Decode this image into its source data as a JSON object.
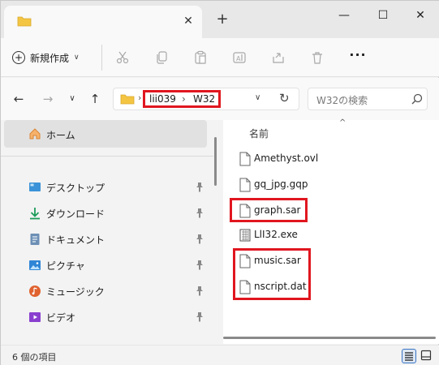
{
  "window": {
    "tab_title": "",
    "controls": {
      "minimize": "—",
      "maximize": "☐",
      "close": "✕"
    }
  },
  "tabbar": {
    "close_glyph": "✕",
    "add_glyph": "+"
  },
  "toolbar": {
    "new_label": "新規作成",
    "new_chevron": "∨",
    "more_glyph": "···",
    "icons": [
      "cut-icon",
      "copy-icon",
      "paste-icon",
      "rename-icon",
      "share-icon",
      "delete-icon"
    ]
  },
  "address": {
    "path": [
      "lii039",
      "W32"
    ],
    "separator": "›",
    "dropdown_glyph": "∨",
    "refresh_glyph": "↻"
  },
  "nav": {
    "back": "←",
    "forward": "→",
    "recent": "∨",
    "up": "↑"
  },
  "search": {
    "placeholder": "W32の検索"
  },
  "sidebar": {
    "home": "ホーム",
    "items": [
      {
        "label": "デスクトップ",
        "icon": "desktop-icon"
      },
      {
        "label": "ダウンロード",
        "icon": "download-icon"
      },
      {
        "label": "ドキュメント",
        "icon": "documents-icon"
      },
      {
        "label": "ピクチャ",
        "icon": "pictures-icon"
      },
      {
        "label": "ミュージック",
        "icon": "music-icon"
      },
      {
        "label": "ビデオ",
        "icon": "videos-icon"
      }
    ]
  },
  "content": {
    "column_header": "名前",
    "sort_glyph": "^",
    "files": [
      {
        "name": "Amethyst.ovl",
        "type": "file"
      },
      {
        "name": "gq_jpg.gqp",
        "type": "file"
      },
      {
        "name": "graph.sar",
        "type": "file"
      },
      {
        "name": "LlI32.exe",
        "type": "exe"
      },
      {
        "name": "music.sar",
        "type": "file"
      },
      {
        "name": "nscript.dat",
        "type": "file"
      }
    ]
  },
  "status": {
    "count_text": "6 個の項目"
  },
  "colors": {
    "highlight": "#e0161f",
    "folder": "#f4c542",
    "accent": "#0a64c8"
  }
}
